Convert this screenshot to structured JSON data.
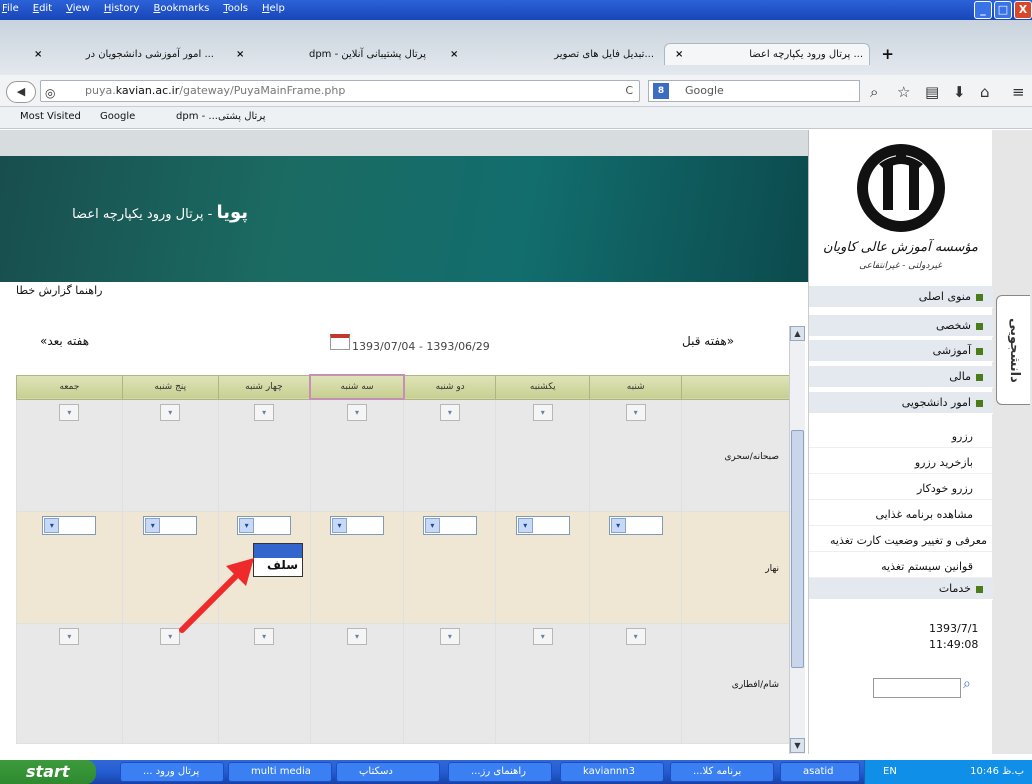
{
  "window": {
    "menu": [
      "File",
      "Edit",
      "View",
      "History",
      "Bookmarks",
      "Tools",
      "Help"
    ],
    "min": "_",
    "max": "□",
    "close": "X"
  },
  "tabs": [
    {
      "label": "... امور آموزشی دانشجویان در",
      "close": "×"
    },
    {
      "label": "پرتال پشتیبانی آنلاین - dpm",
      "close": "×"
    },
    {
      "label": "...تبدیل فایل های تصویر",
      "close": "×"
    },
    {
      "label": "... پرتال ورود یکپارچه اعضا",
      "close": "×",
      "active": true
    }
  ],
  "new_tab": "+",
  "nav": {
    "url_domain": "puya.",
    "url_host": "kavian.ac.ir",
    "url_path": "/gateway/PuyaMainFrame.php",
    "search_placeholder": "Google",
    "back": "◀",
    "reload": "C"
  },
  "bookmarks": {
    "items": [
      "Most Visited",
      "Google",
      "dpm - ...پرتال پشتی"
    ]
  },
  "banner": {
    "title": "پویا",
    "subtitle": " - پرتال ورود یکپارچه اعضا"
  },
  "logo": {
    "line1": "مؤسسه آموزش عالی کاویان",
    "line2": "غیردولتی - غیرانتفاعی"
  },
  "side_tab": "دانشجویی",
  "help_links": "راهنما  گزارش خطا",
  "week": {
    "next": "هفته بعد»",
    "prev": "«هفته قبل",
    "range": "1393/07/04 - 1393/06/29"
  },
  "days": [
    "جمعه",
    "پنج شنبه",
    "چهار شنبه",
    "سه شنبه",
    "دو شنبه",
    "یکشنبه",
    "شنبه"
  ],
  "meals": [
    "صبحانه/سحری",
    "نهار",
    "شام/افطاری"
  ],
  "popup_option": "سلف",
  "sidebar": {
    "main": [
      "منوی اصلی",
      "شخصی",
      "آموزشی",
      "مالی",
      "امور دانشجویی"
    ],
    "sub": [
      "رزرو",
      "بازخرید رزرو",
      "رزرو خودکار",
      "مشاهده برنامه غذایی",
      "معرفی و تغییر وضعیت کارت تغذیه",
      "قوانین سیستم تغذیه"
    ],
    "services": "خدمات",
    "date": "1393/7/1",
    "time": "11:49:08"
  },
  "taskbar": {
    "start": "start",
    "items": [
      "... پرتال ورود",
      "multi media",
      "دسکتاپ",
      "...راهنمای رز",
      "kaviannn3",
      "...برنامه کلا",
      "asatid"
    ],
    "tray_lang": "EN",
    "clock": "10:46 ب.ظ"
  }
}
